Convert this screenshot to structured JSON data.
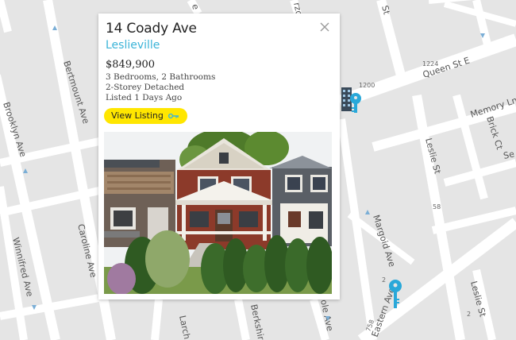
{
  "map": {
    "streets": {
      "bertmount": "Bertmount Ave",
      "brooklyn": "Brooklyn Ave",
      "caroline": "Caroline Ave",
      "winnifred": "Winnifred Ave",
      "queen": "Queen St E",
      "leslie": "Leslie St",
      "leslie2": "Leslie St",
      "memory": "Memory Ln",
      "brick": "Brick Ct",
      "margoid": "Margoid Ave",
      "eastern": "Eastern Ave",
      "se": "Se",
      "larch": "Larch",
      "berkshire": "Berkshire",
      "olea": "ole Ave",
      "rzo": "rzo",
      "top_e": "e",
      "top_st": "St"
    },
    "address_numbers": [
      "1224",
      "1200",
      "58",
      "2",
      "758",
      "2"
    ]
  },
  "listing": {
    "address": "14 Coady Ave",
    "neighbourhood": "Leslieville",
    "price": "$849,900",
    "beds_baths": "3 Bedrooms, 2 Bathrooms",
    "style": "2-Storey Detached",
    "listed": "Listed 1 Days Ago",
    "view_button": "View Listing"
  },
  "icons": {
    "close": "close-icon",
    "key_button": "key-icon",
    "building_marker": "building-icon",
    "key_marker_1": "key-marker-icon",
    "key_marker_2": "key-marker-icon"
  },
  "colors": {
    "map_background": "#e5e5e5",
    "road": "#ffffff",
    "accent_blue": "#3cb4d8",
    "button_yellow": "#ffe600",
    "marker_blue": "#29a8d9"
  }
}
